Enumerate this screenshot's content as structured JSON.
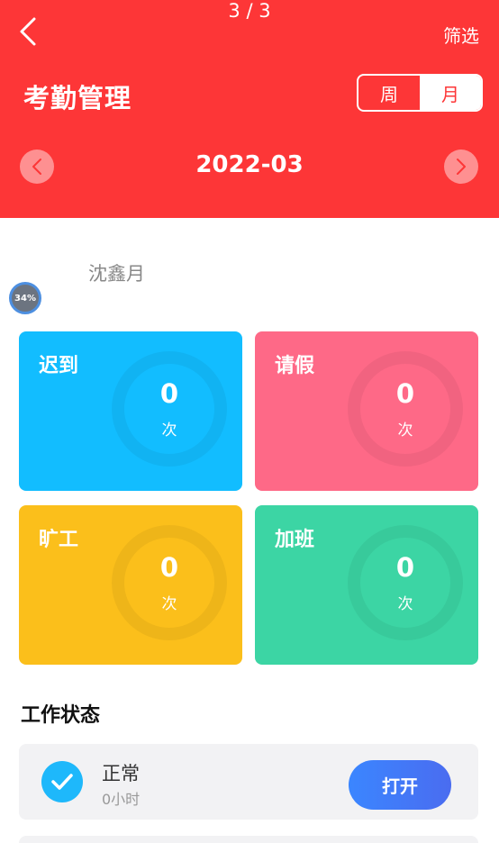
{
  "header": {
    "pager": "3 / 3",
    "filter_label": "筛选",
    "title": "考勤管理",
    "segment": {
      "week": "周",
      "month": "月",
      "selected": "月"
    },
    "month": "2022-03"
  },
  "user": {
    "name": "沈鑫月",
    "progress_badge": "34%"
  },
  "stats": [
    {
      "label": "迟到",
      "value": "0",
      "unit": "次",
      "color": "#12bdff"
    },
    {
      "label": "请假",
      "value": "0",
      "unit": "次",
      "color": "#fe6987"
    },
    {
      "label": "旷工",
      "value": "0",
      "unit": "次",
      "color": "#fbbf1b"
    },
    {
      "label": "加班",
      "value": "0",
      "unit": "次",
      "color": "#3cd5a4"
    }
  ],
  "work_status": {
    "title": "工作状态",
    "status_label": "正常",
    "hours": "0小时",
    "button_label": "打开"
  },
  "colors": {
    "header_bg": "#fd3637",
    "accent_blue": "#3b86ff"
  }
}
